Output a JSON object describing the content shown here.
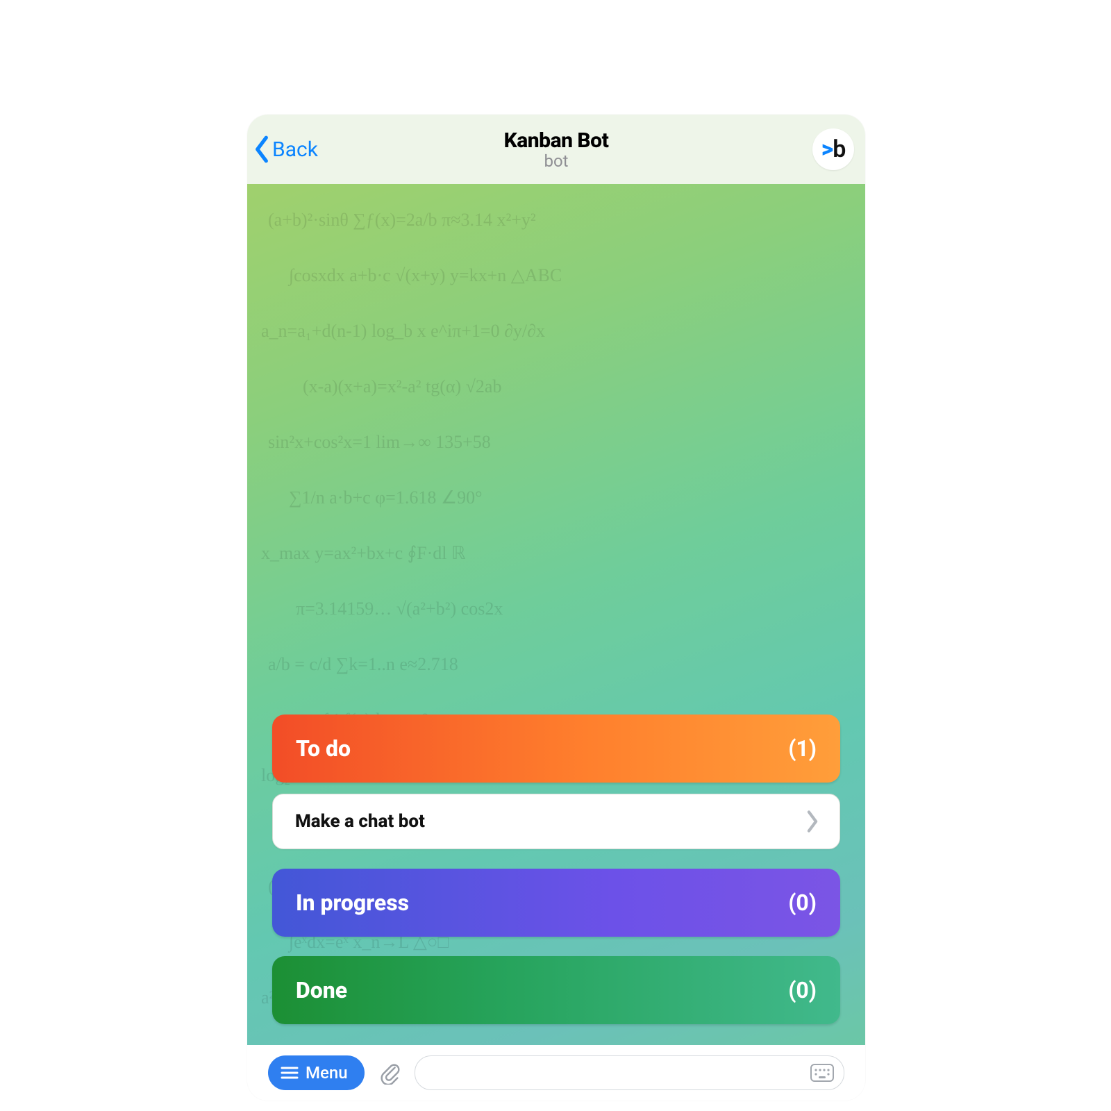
{
  "header": {
    "back_label": "Back",
    "title": "Kanban Bot",
    "subtitle": "bot",
    "avatar_text_prefix": ">",
    "avatar_text_main": "b"
  },
  "boards": {
    "todo": {
      "label": "To do",
      "count": "(1)"
    },
    "inprogress": {
      "label": "In progress",
      "count": "(0)"
    },
    "done": {
      "label": "Done",
      "count": "(0)"
    }
  },
  "tasks": {
    "todo_items": [
      {
        "title": "Make a chat bot"
      }
    ]
  },
  "inputbar": {
    "menu_label": "Menu",
    "message_placeholder": ""
  },
  "colors": {
    "primary_blue": "#0b84ff",
    "menu_blue": "#2f7ff0"
  }
}
